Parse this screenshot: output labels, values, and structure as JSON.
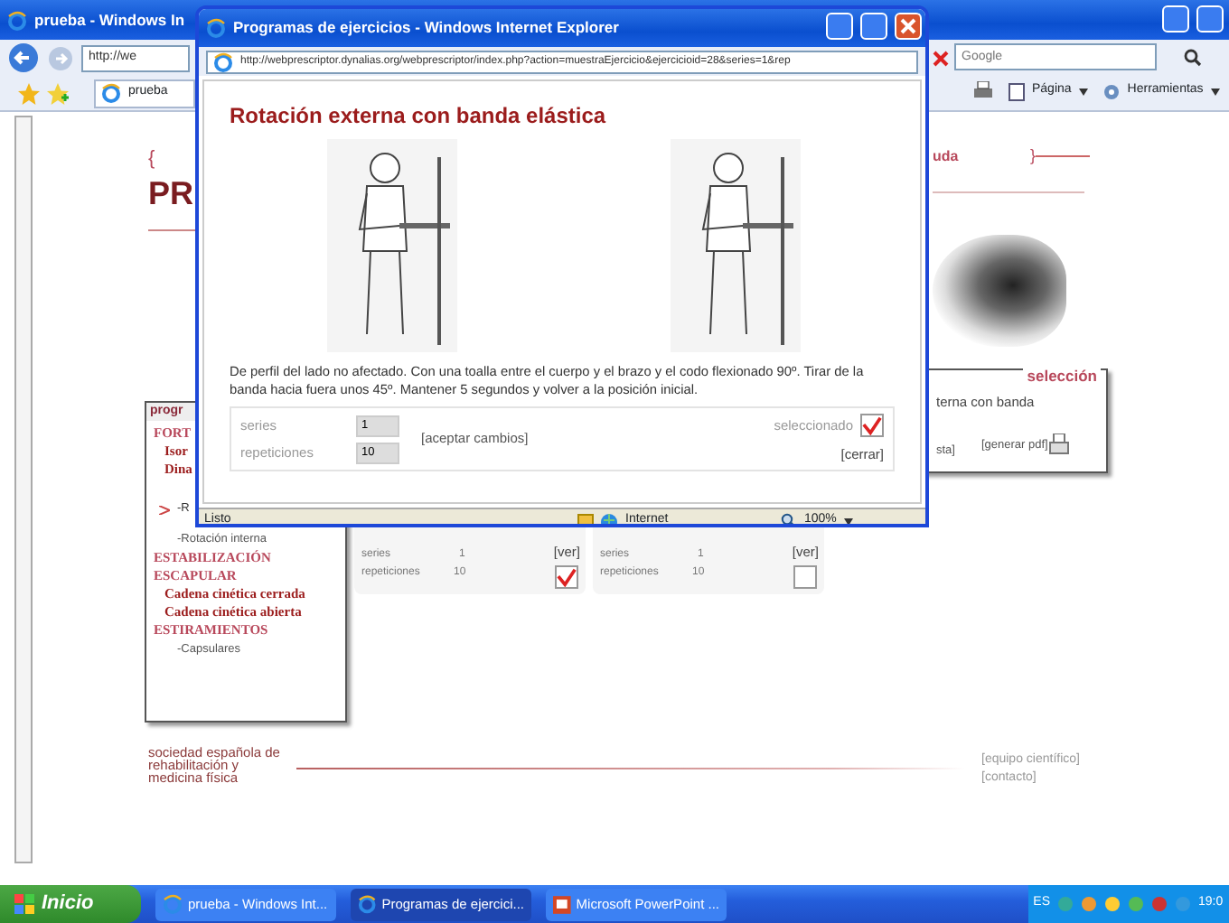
{
  "browser": {
    "title": "prueba - Windows In",
    "address": "http://we",
    "search_placeholder": "Google",
    "tab": "prueba",
    "toolbar": [
      {
        "kind": "print"
      },
      {
        "kind": "page",
        "label": "Página"
      },
      {
        "kind": "tools",
        "label": "Herramientas"
      }
    ]
  },
  "page": {
    "top_bracket": "{",
    "heading": "PR",
    "nav_link": "uda",
    "nav_bracket": "}",
    "menu": {
      "header": "progr",
      "items": [
        {
          "kind": "section",
          "label": "FORT"
        },
        {
          "kind": "group",
          "label": "Isor"
        },
        {
          "kind": "group",
          "label": "Dina"
        },
        {
          "kind": "item",
          "label": "-R",
          "selected": true
        },
        {
          "kind": "item",
          "label": "-Rotación interna",
          "selected": false
        },
        {
          "kind": "section",
          "label": "ESTABILIZACIÓN ESCAPULAR"
        },
        {
          "kind": "group",
          "label": "Cadena cinética cerrada"
        },
        {
          "kind": "group",
          "label": "Cadena cinética abierta"
        },
        {
          "kind": "section",
          "label": "ESTIRAMIENTOS"
        },
        {
          "kind": "item",
          "label": "-Capsulares",
          "selected": false
        }
      ]
    },
    "selection": {
      "title": "selección",
      "text": "terna con banda",
      "link_1": "sta]",
      "link_2": "[generar pdf]"
    },
    "cards": [
      {
        "series_label": "series",
        "series": "1",
        "reps_label": "repeticiones",
        "reps": "10",
        "link": "[ver]",
        "checked": true
      },
      {
        "series_label": "series",
        "series": "1",
        "reps_label": "repeticiones",
        "reps": "10",
        "link": "[ver]",
        "checked": false
      }
    ],
    "footer": {
      "society": "sociedad española de rehabilitación y medicina física",
      "links": [
        "[equipo científico]",
        "[contacto]"
      ]
    }
  },
  "popup": {
    "title": "Programas de ejercicios - Windows Internet Explorer",
    "address": "http://webprescriptor.dynalias.org/webprescriptor/index.php?action=muestraEjercicio&ejercicioid=28&series=1&rep",
    "exercise_title": "Rotación externa con banda elástica",
    "description": "De perfil del lado no afectado. Con una toalla entre el cuerpo y el brazo y el codo flexionado 90º. Tirar de la banda hacia fuera unos 45º. Mantener 5 segundos y volver a la posición inicial.",
    "series_label": "series",
    "series": "1",
    "reps_label": "repeticiones",
    "reps": "10",
    "accept": "[aceptar cambios]",
    "selected_label": "seleccionado",
    "selected": true,
    "close": "[cerrar]",
    "status": "Listo",
    "zone": "Internet",
    "zoom": "100%"
  },
  "taskbar": {
    "start": "Inicio",
    "tasks": [
      {
        "kind": "ie",
        "label": "prueba - Windows Int...",
        "selected": false
      },
      {
        "kind": "ie",
        "label": "Programas de ejercici...",
        "selected": true
      },
      {
        "kind": "ppt",
        "label": "Microsoft PowerPoint ...",
        "selected": false
      }
    ],
    "language": "ES",
    "clock": "19:0"
  }
}
